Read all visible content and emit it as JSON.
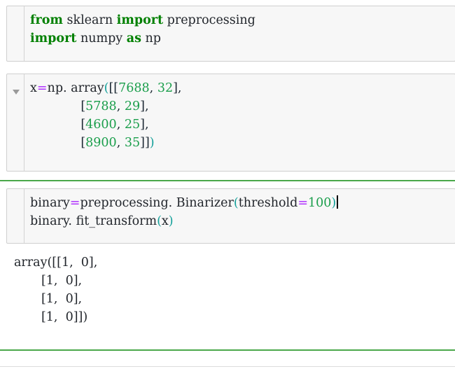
{
  "app": {
    "kind": "jupyter-notebook",
    "accent_green": "#4aa84a",
    "cell_background": "#f7f7f7",
    "cell_border": "#cfcfcf",
    "keyword_color": "#008000",
    "number_color": "#1a9e4b",
    "operator_color": "#aa22ff",
    "paren_color": "#14a09a",
    "text_color": "#21252b"
  },
  "cells": [
    {
      "name": "import-cell",
      "lines": [
        {
          "tokens": [
            {
              "t": "from",
              "c": "kw"
            },
            {
              "t": " sklearn ",
              "c": "name"
            },
            {
              "t": "import",
              "c": "kw"
            },
            {
              "t": " preprocessing",
              "c": "name"
            }
          ]
        },
        {
          "tokens": [
            {
              "t": "import",
              "c": "kw"
            },
            {
              "t": " numpy ",
              "c": "name"
            },
            {
              "t": "as",
              "c": "kw"
            },
            {
              "t": " np",
              "c": "name"
            }
          ]
        }
      ]
    },
    {
      "name": "array-definition-cell",
      "has_collapse_arrow": true,
      "lines": [
        {
          "tokens": [
            {
              "t": "x",
              "c": "name"
            },
            {
              "t": "=",
              "c": "op"
            },
            {
              "t": "np.",
              "c": "name"
            },
            {
              "t": " array",
              "c": "name"
            },
            {
              "t": "(",
              "c": "paren"
            },
            {
              "t": "[[",
              "c": "punc"
            },
            {
              "t": "7688",
              "c": "num"
            },
            {
              "t": ", ",
              "c": "punc"
            },
            {
              "t": "32",
              "c": "num"
            },
            {
              "t": "],",
              "c": "punc"
            }
          ]
        },
        {
          "tokens": [
            {
              "t": "             [",
              "c": "punc"
            },
            {
              "t": "5788",
              "c": "num"
            },
            {
              "t": ", ",
              "c": "punc"
            },
            {
              "t": "29",
              "c": "num"
            },
            {
              "t": "],",
              "c": "punc"
            }
          ]
        },
        {
          "tokens": [
            {
              "t": "             [",
              "c": "punc"
            },
            {
              "t": "4600",
              "c": "num"
            },
            {
              "t": ", ",
              "c": "punc"
            },
            {
              "t": "25",
              "c": "num"
            },
            {
              "t": "],",
              "c": "punc"
            }
          ]
        },
        {
          "tokens": [
            {
              "t": "             [",
              "c": "punc"
            },
            {
              "t": "8900",
              "c": "num"
            },
            {
              "t": ", ",
              "c": "punc"
            },
            {
              "t": "35",
              "c": "num"
            },
            {
              "t": "]]",
              "c": "punc"
            },
            {
              "t": ")",
              "c": "paren"
            }
          ]
        }
      ]
    },
    {
      "name": "binarizer-cell",
      "selected": true,
      "has_caret": true,
      "lines": [
        {
          "tokens": [
            {
              "t": "binary",
              "c": "name"
            },
            {
              "t": "=",
              "c": "op"
            },
            {
              "t": "preprocessing.",
              "c": "name"
            },
            {
              "t": " Binarizer",
              "c": "name"
            },
            {
              "t": "(",
              "c": "paren"
            },
            {
              "t": "threshold",
              "c": "name"
            },
            {
              "t": "=",
              "c": "op"
            },
            {
              "t": "100",
              "c": "num"
            },
            {
              "t": ")",
              "c": "paren"
            }
          ],
          "caret": true
        },
        {
          "tokens": [
            {
              "t": "binary.",
              "c": "name"
            },
            {
              "t": " fit_transform",
              "c": "name"
            },
            {
              "t": "(",
              "c": "paren"
            },
            {
              "t": "x",
              "c": "name"
            },
            {
              "t": ")",
              "c": "paren"
            }
          ]
        }
      ]
    }
  ],
  "output": {
    "name": "array-output",
    "lines": [
      "array([[1,  0],",
      "       [1,  0],",
      "       [1,  0],",
      "       [1,  0]])"
    ]
  }
}
